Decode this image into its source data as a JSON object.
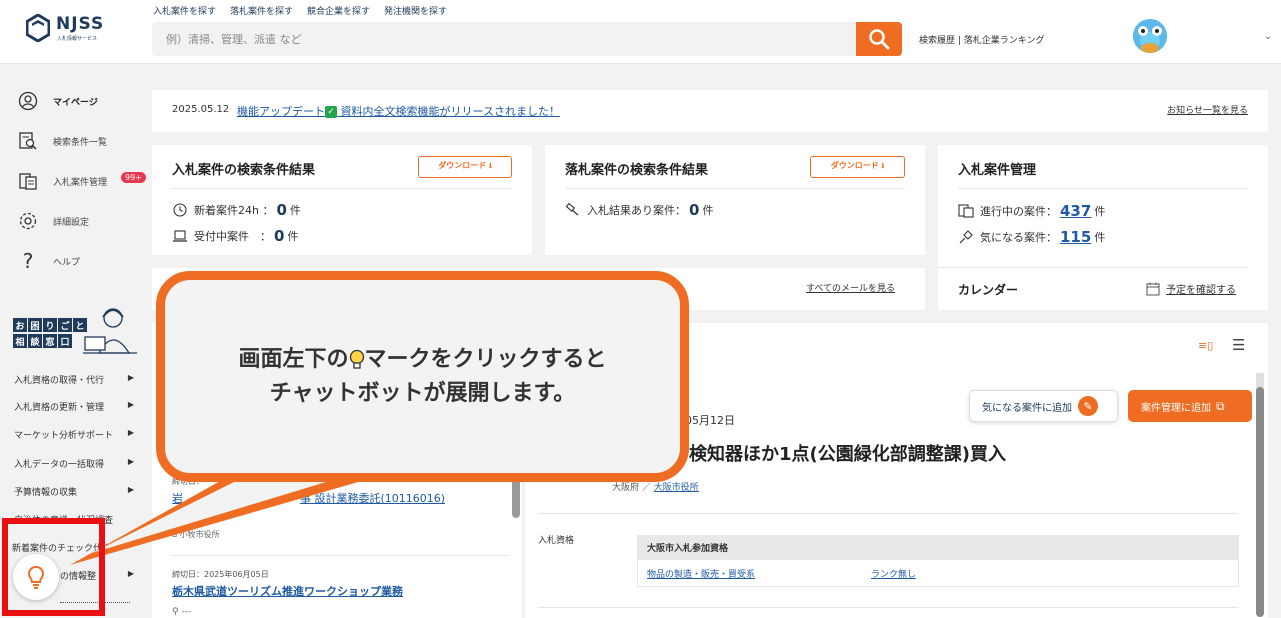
{
  "header": {
    "logo_text": "NJSS",
    "logo_sub": "入札情報サービス",
    "nav": [
      "入札案件を探す",
      "落札案件を探す",
      "競合企業を探す",
      "発注機関を探す"
    ],
    "search_placeholder": "例）清掃、管理、派遣 など",
    "links": "検索履歴 | 落札企業ランキング"
  },
  "sidebar": {
    "items": [
      {
        "label": "マイページ",
        "icon": "user-circle-icon"
      },
      {
        "label": "検索条件一覧",
        "icon": "search-list-icon"
      },
      {
        "label": "入札案件管理",
        "icon": "document-icon",
        "badge": "99+"
      },
      {
        "label": "詳細設定",
        "icon": "gear-icon"
      },
      {
        "label": "ヘルプ",
        "icon": "question-icon"
      }
    ],
    "help_title": [
      "お",
      "困",
      "り",
      "ご",
      "と",
      "相",
      "談",
      "窓",
      "口"
    ],
    "links": [
      "入札資格の取得・代行",
      "入札資格の更新・管理",
      "マーケット分析サポート",
      "入札データの一括取得",
      "予算情報の収集",
      "自治体の意識・状況調査",
      "新着案件のチェック代行",
      "の情報整"
    ]
  },
  "news": {
    "date": "2025.05.12",
    "message_pre": "機能アップデート",
    "check": "✓",
    "message_post": "資料内全文検索機能がリリースされました！",
    "more": "お知らせ一覧を見る"
  },
  "bid_search": {
    "title": "入札案件の検索条件結果",
    "download": "ダウンロード ⭳",
    "new_label": "新着案件24h ：",
    "new_count": "0",
    "new_unit": "件",
    "open_label": "受付中案件　：",
    "open_count": "0",
    "open_unit": "件"
  },
  "award_search": {
    "title": "落札案件の検索条件結果",
    "download": "ダウンロード ⭳",
    "result_label": "入札結果あり案件：",
    "result_count": "0",
    "result_unit": "件"
  },
  "bid_manage": {
    "title": "入札案件管理",
    "progress_label": "進行中の案件：",
    "progress_count": "437",
    "progress_unit": "件",
    "fav_label": "気になる案件：",
    "fav_count": "115",
    "fav_unit": "件",
    "calendar_title": "カレンダー",
    "calendar_link": "予定を確認する"
  },
  "mail": {
    "more": "すべてのメールを見る"
  },
  "callout": {
    "line1_pre": "画面左下の",
    "line1_post": "マークをクリックすると",
    "line2": "チャットボットが展開します。"
  },
  "list": {
    "item1_deadline": "締切日：",
    "item1_title_pre": "岩",
    "item1_title_post": "事 設計業務委託(10116016)",
    "item1_org": "小牧市役所",
    "item2_deadline": "締切日：2025年06月05日",
    "item2_title": "栃木県武道ツーリズム推進ワークショップ業務",
    "item2_org": "---"
  },
  "detail": {
    "date_frag": "05月12日",
    "title_frag": "ル検知器ほか1点(公園緑化部調整課)買入",
    "pref": "大阪府",
    "sep": "／",
    "org": "大阪市役所",
    "fav_button": "気になる案件に追加",
    "manage_button": "案件管理に追加",
    "qual_label": "入札資格",
    "qual_head": "大阪市入札参加資格",
    "qual_cat": "物品の製造・販売・買受系",
    "qual_rank": "ランク無し"
  },
  "colors": {
    "accent": "#ef6d22",
    "navy": "#1f3a5a",
    "link": "#1f5aa5",
    "alert": "#e81010"
  }
}
